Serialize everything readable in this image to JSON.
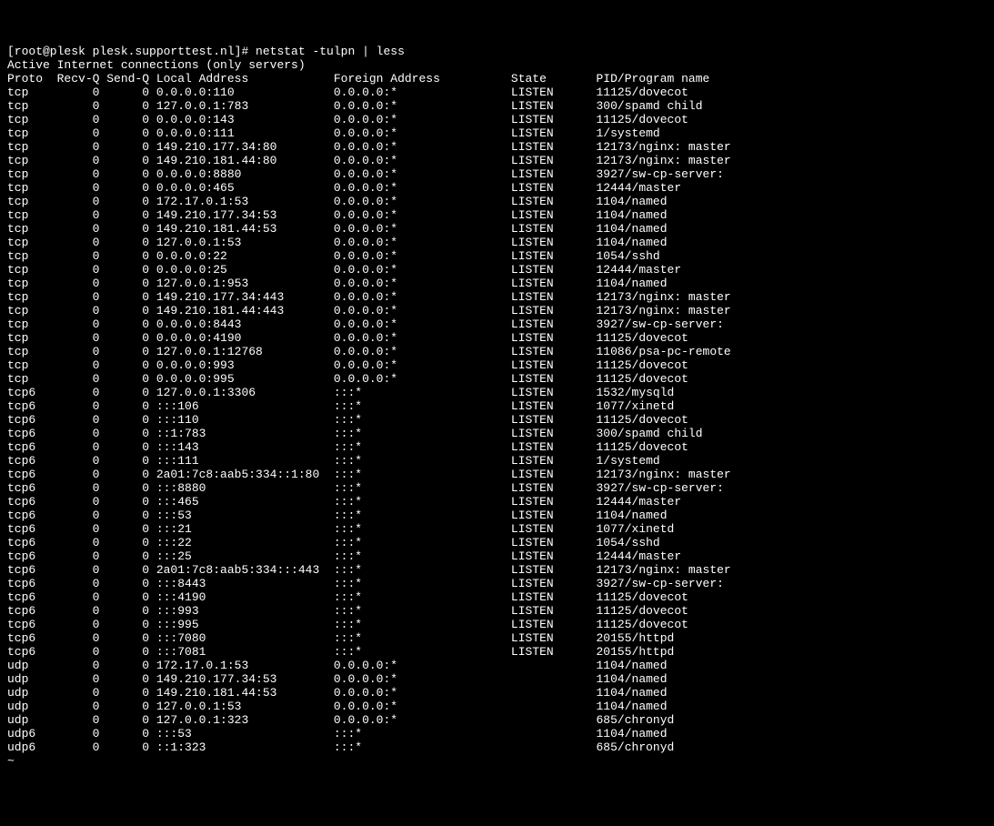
{
  "prompt": "[root@plesk plesk.supporttest.nl]# netstat -tulpn | less",
  "title": "Active Internet connections (only servers)",
  "headers": {
    "proto": "Proto",
    "recvq": "Recv-Q",
    "sendq": "Send-Q",
    "local": "Local Address",
    "foreign": "Foreign Address",
    "state": "State",
    "pid": "PID/Program name"
  },
  "rows": [
    {
      "proto": "tcp",
      "recvq": "0",
      "sendq": "0",
      "local": "0.0.0.0:110",
      "foreign": "0.0.0.0:*",
      "state": "LISTEN",
      "pid": "11125/dovecot"
    },
    {
      "proto": "tcp",
      "recvq": "0",
      "sendq": "0",
      "local": "127.0.0.1:783",
      "foreign": "0.0.0.0:*",
      "state": "LISTEN",
      "pid": "300/spamd child"
    },
    {
      "proto": "tcp",
      "recvq": "0",
      "sendq": "0",
      "local": "0.0.0.0:143",
      "foreign": "0.0.0.0:*",
      "state": "LISTEN",
      "pid": "11125/dovecot"
    },
    {
      "proto": "tcp",
      "recvq": "0",
      "sendq": "0",
      "local": "0.0.0.0:111",
      "foreign": "0.0.0.0:*",
      "state": "LISTEN",
      "pid": "1/systemd"
    },
    {
      "proto": "tcp",
      "recvq": "0",
      "sendq": "0",
      "local": "149.210.177.34:80",
      "foreign": "0.0.0.0:*",
      "state": "LISTEN",
      "pid": "12173/nginx: master"
    },
    {
      "proto": "tcp",
      "recvq": "0",
      "sendq": "0",
      "local": "149.210.181.44:80",
      "foreign": "0.0.0.0:*",
      "state": "LISTEN",
      "pid": "12173/nginx: master"
    },
    {
      "proto": "tcp",
      "recvq": "0",
      "sendq": "0",
      "local": "0.0.0.0:8880",
      "foreign": "0.0.0.0:*",
      "state": "LISTEN",
      "pid": "3927/sw-cp-server:"
    },
    {
      "proto": "tcp",
      "recvq": "0",
      "sendq": "0",
      "local": "0.0.0.0:465",
      "foreign": "0.0.0.0:*",
      "state": "LISTEN",
      "pid": "12444/master"
    },
    {
      "proto": "tcp",
      "recvq": "0",
      "sendq": "0",
      "local": "172.17.0.1:53",
      "foreign": "0.0.0.0:*",
      "state": "LISTEN",
      "pid": "1104/named"
    },
    {
      "proto": "tcp",
      "recvq": "0",
      "sendq": "0",
      "local": "149.210.177.34:53",
      "foreign": "0.0.0.0:*",
      "state": "LISTEN",
      "pid": "1104/named"
    },
    {
      "proto": "tcp",
      "recvq": "0",
      "sendq": "0",
      "local": "149.210.181.44:53",
      "foreign": "0.0.0.0:*",
      "state": "LISTEN",
      "pid": "1104/named"
    },
    {
      "proto": "tcp",
      "recvq": "0",
      "sendq": "0",
      "local": "127.0.0.1:53",
      "foreign": "0.0.0.0:*",
      "state": "LISTEN",
      "pid": "1104/named"
    },
    {
      "proto": "tcp",
      "recvq": "0",
      "sendq": "0",
      "local": "0.0.0.0:22",
      "foreign": "0.0.0.0:*",
      "state": "LISTEN",
      "pid": "1054/sshd"
    },
    {
      "proto": "tcp",
      "recvq": "0",
      "sendq": "0",
      "local": "0.0.0.0:25",
      "foreign": "0.0.0.0:*",
      "state": "LISTEN",
      "pid": "12444/master"
    },
    {
      "proto": "tcp",
      "recvq": "0",
      "sendq": "0",
      "local": "127.0.0.1:953",
      "foreign": "0.0.0.0:*",
      "state": "LISTEN",
      "pid": "1104/named"
    },
    {
      "proto": "tcp",
      "recvq": "0",
      "sendq": "0",
      "local": "149.210.177.34:443",
      "foreign": "0.0.0.0:*",
      "state": "LISTEN",
      "pid": "12173/nginx: master"
    },
    {
      "proto": "tcp",
      "recvq": "0",
      "sendq": "0",
      "local": "149.210.181.44:443",
      "foreign": "0.0.0.0:*",
      "state": "LISTEN",
      "pid": "12173/nginx: master"
    },
    {
      "proto": "tcp",
      "recvq": "0",
      "sendq": "0",
      "local": "0.0.0.0:8443",
      "foreign": "0.0.0.0:*",
      "state": "LISTEN",
      "pid": "3927/sw-cp-server:"
    },
    {
      "proto": "tcp",
      "recvq": "0",
      "sendq": "0",
      "local": "0.0.0.0:4190",
      "foreign": "0.0.0.0:*",
      "state": "LISTEN",
      "pid": "11125/dovecot"
    },
    {
      "proto": "tcp",
      "recvq": "0",
      "sendq": "0",
      "local": "127.0.0.1:12768",
      "foreign": "0.0.0.0:*",
      "state": "LISTEN",
      "pid": "11086/psa-pc-remote"
    },
    {
      "proto": "tcp",
      "recvq": "0",
      "sendq": "0",
      "local": "0.0.0.0:993",
      "foreign": "0.0.0.0:*",
      "state": "LISTEN",
      "pid": "11125/dovecot"
    },
    {
      "proto": "tcp",
      "recvq": "0",
      "sendq": "0",
      "local": "0.0.0.0:995",
      "foreign": "0.0.0.0:*",
      "state": "LISTEN",
      "pid": "11125/dovecot"
    },
    {
      "proto": "tcp6",
      "recvq": "0",
      "sendq": "0",
      "local": "127.0.0.1:3306",
      "foreign": ":::*",
      "state": "LISTEN",
      "pid": "1532/mysqld"
    },
    {
      "proto": "tcp6",
      "recvq": "0",
      "sendq": "0",
      "local": ":::106",
      "foreign": ":::*",
      "state": "LISTEN",
      "pid": "1077/xinetd"
    },
    {
      "proto": "tcp6",
      "recvq": "0",
      "sendq": "0",
      "local": ":::110",
      "foreign": ":::*",
      "state": "LISTEN",
      "pid": "11125/dovecot"
    },
    {
      "proto": "tcp6",
      "recvq": "0",
      "sendq": "0",
      "local": "::1:783",
      "foreign": ":::*",
      "state": "LISTEN",
      "pid": "300/spamd child"
    },
    {
      "proto": "tcp6",
      "recvq": "0",
      "sendq": "0",
      "local": ":::143",
      "foreign": ":::*",
      "state": "LISTEN",
      "pid": "11125/dovecot"
    },
    {
      "proto": "tcp6",
      "recvq": "0",
      "sendq": "0",
      "local": ":::111",
      "foreign": ":::*",
      "state": "LISTEN",
      "pid": "1/systemd"
    },
    {
      "proto": "tcp6",
      "recvq": "0",
      "sendq": "0",
      "local": "2a01:7c8:aab5:334::1:80",
      "foreign": ":::*",
      "state": "LISTEN",
      "pid": "12173/nginx: master"
    },
    {
      "proto": "tcp6",
      "recvq": "0",
      "sendq": "0",
      "local": ":::8880",
      "foreign": ":::*",
      "state": "LISTEN",
      "pid": "3927/sw-cp-server:"
    },
    {
      "proto": "tcp6",
      "recvq": "0",
      "sendq": "0",
      "local": ":::465",
      "foreign": ":::*",
      "state": "LISTEN",
      "pid": "12444/master"
    },
    {
      "proto": "tcp6",
      "recvq": "0",
      "sendq": "0",
      "local": ":::53",
      "foreign": ":::*",
      "state": "LISTEN",
      "pid": "1104/named"
    },
    {
      "proto": "tcp6",
      "recvq": "0",
      "sendq": "0",
      "local": ":::21",
      "foreign": ":::*",
      "state": "LISTEN",
      "pid": "1077/xinetd"
    },
    {
      "proto": "tcp6",
      "recvq": "0",
      "sendq": "0",
      "local": ":::22",
      "foreign": ":::*",
      "state": "LISTEN",
      "pid": "1054/sshd"
    },
    {
      "proto": "tcp6",
      "recvq": "0",
      "sendq": "0",
      "local": ":::25",
      "foreign": ":::*",
      "state": "LISTEN",
      "pid": "12444/master"
    },
    {
      "proto": "tcp6",
      "recvq": "0",
      "sendq": "0",
      "local": "2a01:7c8:aab5:334:::443",
      "foreign": ":::*",
      "state": "LISTEN",
      "pid": "12173/nginx: master"
    },
    {
      "proto": "tcp6",
      "recvq": "0",
      "sendq": "0",
      "local": ":::8443",
      "foreign": ":::*",
      "state": "LISTEN",
      "pid": "3927/sw-cp-server:"
    },
    {
      "proto": "tcp6",
      "recvq": "0",
      "sendq": "0",
      "local": ":::4190",
      "foreign": ":::*",
      "state": "LISTEN",
      "pid": "11125/dovecot"
    },
    {
      "proto": "tcp6",
      "recvq": "0",
      "sendq": "0",
      "local": ":::993",
      "foreign": ":::*",
      "state": "LISTEN",
      "pid": "11125/dovecot"
    },
    {
      "proto": "tcp6",
      "recvq": "0",
      "sendq": "0",
      "local": ":::995",
      "foreign": ":::*",
      "state": "LISTEN",
      "pid": "11125/dovecot"
    },
    {
      "proto": "tcp6",
      "recvq": "0",
      "sendq": "0",
      "local": ":::7080",
      "foreign": ":::*",
      "state": "LISTEN",
      "pid": "20155/httpd"
    },
    {
      "proto": "tcp6",
      "recvq": "0",
      "sendq": "0",
      "local": ":::7081",
      "foreign": ":::*",
      "state": "LISTEN",
      "pid": "20155/httpd"
    },
    {
      "proto": "udp",
      "recvq": "0",
      "sendq": "0",
      "local": "172.17.0.1:53",
      "foreign": "0.0.0.0:*",
      "state": "",
      "pid": "1104/named"
    },
    {
      "proto": "udp",
      "recvq": "0",
      "sendq": "0",
      "local": "149.210.177.34:53",
      "foreign": "0.0.0.0:*",
      "state": "",
      "pid": "1104/named"
    },
    {
      "proto": "udp",
      "recvq": "0",
      "sendq": "0",
      "local": "149.210.181.44:53",
      "foreign": "0.0.0.0:*",
      "state": "",
      "pid": "1104/named"
    },
    {
      "proto": "udp",
      "recvq": "0",
      "sendq": "0",
      "local": "127.0.0.1:53",
      "foreign": "0.0.0.0:*",
      "state": "",
      "pid": "1104/named"
    },
    {
      "proto": "udp",
      "recvq": "0",
      "sendq": "0",
      "local": "127.0.0.1:323",
      "foreign": "0.0.0.0:*",
      "state": "",
      "pid": "685/chronyd"
    },
    {
      "proto": "udp6",
      "recvq": "0",
      "sendq": "0",
      "local": ":::53",
      "foreign": ":::*",
      "state": "",
      "pid": "1104/named"
    },
    {
      "proto": "udp6",
      "recvq": "0",
      "sendq": "0",
      "local": "::1:323",
      "foreign": ":::*",
      "state": "",
      "pid": "685/chronyd"
    }
  ],
  "tilde": "~"
}
